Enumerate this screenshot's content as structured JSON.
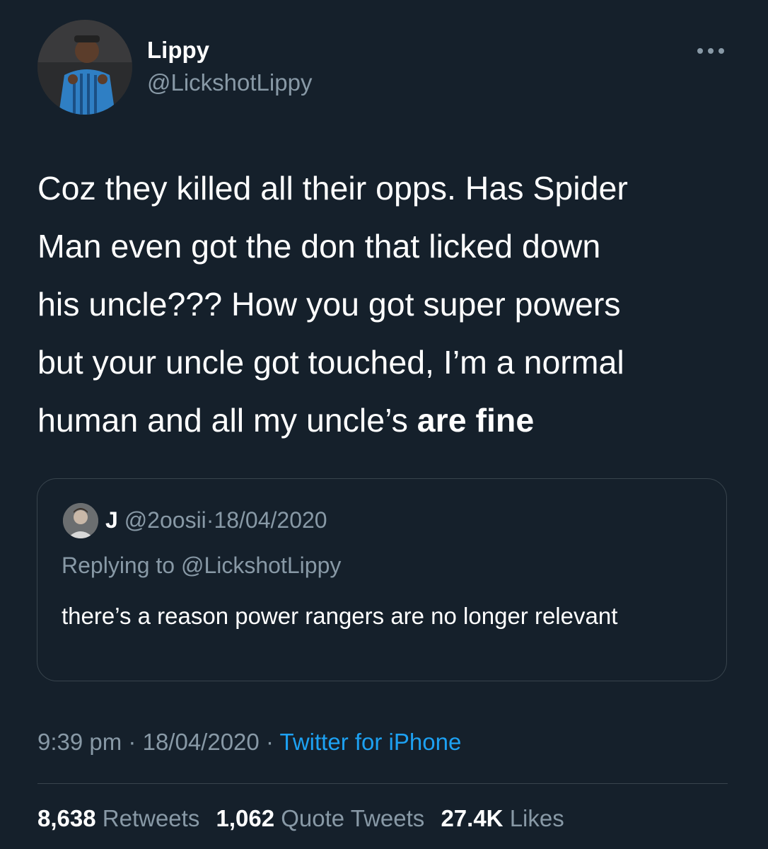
{
  "author": {
    "name": "Lippy",
    "handle": "@LickshotLippy"
  },
  "tweet": {
    "lines": [
      "Coz they killed all their opps. Has Spider",
      "Man even got the don that licked down",
      "his uncle??? How you got super powers",
      "but your uncle got touched, I’m a normal"
    ],
    "last_line_plain": "human and all my uncle’s ",
    "last_line_bold": "are fine"
  },
  "quoted": {
    "name": "J",
    "handle": "@2oosii",
    "separator": "·",
    "date": "18/04/2020",
    "replying_to": "Replying to @LickshotLippy",
    "text": "there’s a reason power rangers are no longer relevant"
  },
  "meta": {
    "time": "9:39 pm",
    "sep1": "·",
    "date": "18/04/2020",
    "sep2": "·",
    "source": "Twitter for iPhone"
  },
  "stats": {
    "retweets_count": "8,638",
    "retweets_label": "Retweets",
    "quotes_count": "1,062",
    "quotes_label": "Quote Tweets",
    "likes_count": "27.4K",
    "likes_label": "Likes"
  },
  "icons": {
    "more": "more-horizontal-icon"
  },
  "colors": {
    "background": "#15202b",
    "secondary_text": "#8899a6",
    "link": "#1da1f2",
    "border": "#38444d"
  }
}
